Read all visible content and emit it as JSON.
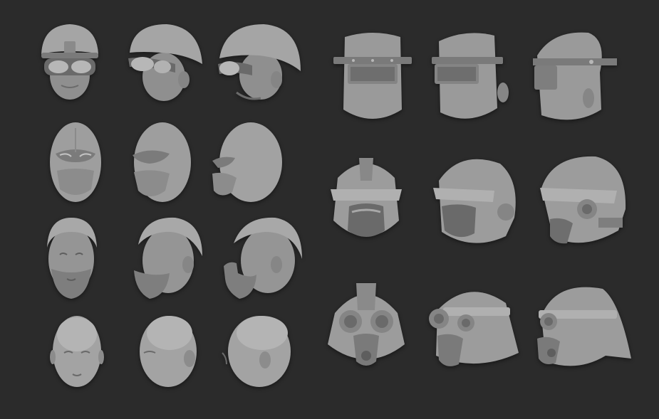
{
  "scene": {
    "background": "#2b2b2b",
    "sculpt_color": "#9a9a9a",
    "highlight_color": "#c4c4c4",
    "shadow_color": "#5a5a5a",
    "left_group_views": [
      "front",
      "three-quarter",
      "profile"
    ],
    "right_group_views": [
      "front",
      "three-quarter",
      "profile"
    ]
  },
  "left_group": {
    "rows": [
      {
        "name": "soldier-helmet-goggles",
        "icon": "helmet-goggles-icon"
      },
      {
        "name": "masked-hood",
        "icon": "mask-hood-icon"
      },
      {
        "name": "bearded-man",
        "icon": "bearded-head-icon"
      },
      {
        "name": "bald-man",
        "icon": "bald-head-icon"
      }
    ]
  },
  "right_group": {
    "rows": [
      {
        "name": "welder-helmet",
        "icon": "welder-helmet-icon"
      },
      {
        "name": "armored-helmet",
        "icon": "armored-helmet-icon"
      },
      {
        "name": "gas-mask-helmet",
        "icon": "gasmask-helmet-icon"
      }
    ]
  }
}
